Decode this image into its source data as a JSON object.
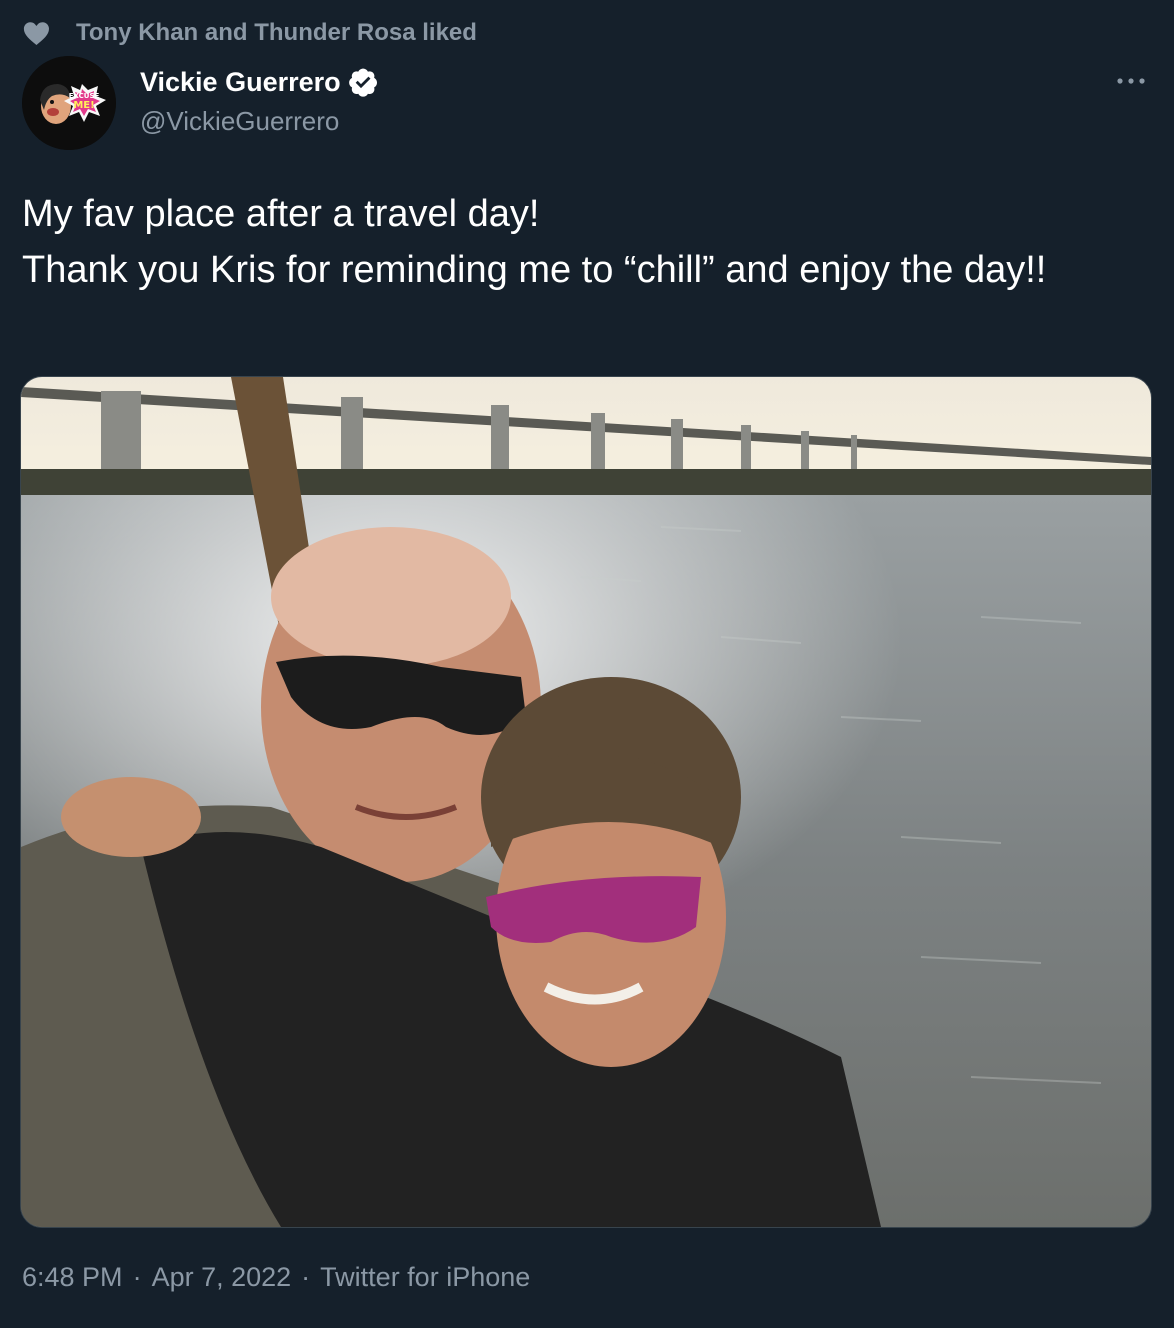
{
  "social_context": {
    "text": "Tony Khan and Thunder Rosa liked",
    "icon": "heart-icon"
  },
  "author": {
    "display_name": "Vickie Guerrero",
    "handle": "@VickieGuerrero",
    "verified": true,
    "avatar_text_top": "EXCUSE",
    "avatar_text_bottom": "ME!"
  },
  "tweet": {
    "text": "My fav place after a travel day!\nThank you Kris for reminding me to “chill” and enjoy the day!!"
  },
  "media": {
    "kind": "photo"
  },
  "meta": {
    "time": "6:48 PM",
    "date": "Apr 7, 2022",
    "source": "Twitter for iPhone",
    "separator": "·"
  },
  "colors": {
    "background": "#15202b",
    "secondary_text": "#8b98a5",
    "verified_badge": "#ffffff",
    "border": "#38444d"
  }
}
